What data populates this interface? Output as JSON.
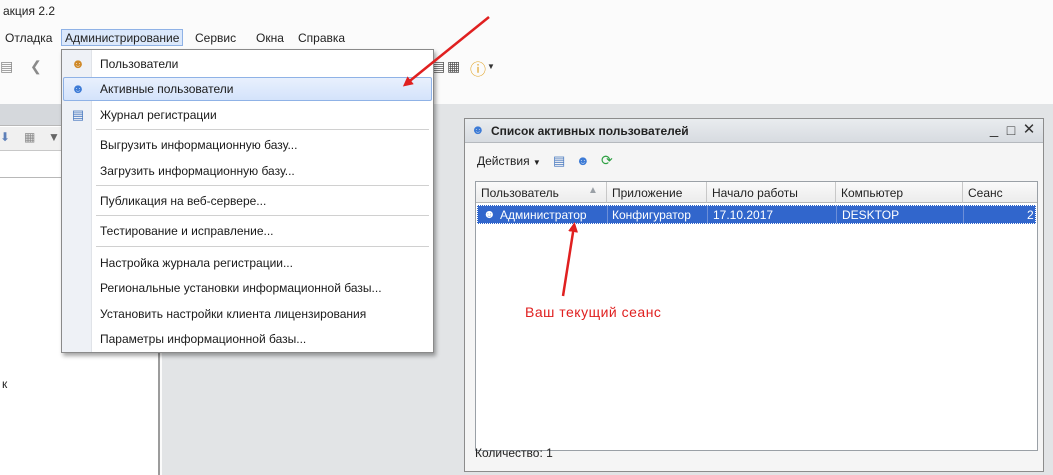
{
  "app": {
    "title": "акция 2.2"
  },
  "menu": {
    "items": [
      {
        "label": "Отладка"
      },
      {
        "label": "Администрирование"
      },
      {
        "label": "Сервис"
      },
      {
        "label": "Окна"
      },
      {
        "label": "Справка"
      }
    ]
  },
  "dropdown": {
    "items": [
      {
        "label": "Пользователи",
        "icon": "user-icon"
      },
      {
        "label": "Активные пользователи",
        "icon": "active-users-icon"
      },
      {
        "label": "Журнал регистрации",
        "icon": "log-icon"
      },
      {
        "label": "Выгрузить информационную базу...",
        "icon": ""
      },
      {
        "label": "Загрузить информационную базу...",
        "icon": ""
      },
      {
        "label": "Публикация на веб-сервере...",
        "icon": ""
      },
      {
        "label": "Тестирование и исправление...",
        "icon": ""
      },
      {
        "label": "Настройка журнала регистрации...",
        "icon": ""
      },
      {
        "label": "Региональные установки информационной базы...",
        "icon": ""
      },
      {
        "label": "Установить настройки клиента лицензирования",
        "icon": ""
      },
      {
        "label": "Параметры информационной базы...",
        "icon": ""
      }
    ]
  },
  "left_pane": {
    "stray_text": "к"
  },
  "active_users_window": {
    "title": "Список активных пользователей",
    "toolbar": {
      "actions_label": "Действия"
    },
    "table": {
      "columns": [
        "Пользователь",
        "Приложение",
        "Начало работы",
        "Компьютер",
        "Сеанс"
      ],
      "rows": [
        [
          "Администратор",
          "Конфигуратор",
          "17.10.2017",
          "DESKTOP",
          "2"
        ]
      ]
    },
    "count_label": "Количество:",
    "count_value": "1"
  },
  "annotation": {
    "text": "Ваш текущий сеанс",
    "color": "#e02020"
  },
  "colors": {
    "selection": "#3166cc",
    "menu_highlight": "#dbe8fb",
    "accent_border": "#8fb2e6"
  }
}
